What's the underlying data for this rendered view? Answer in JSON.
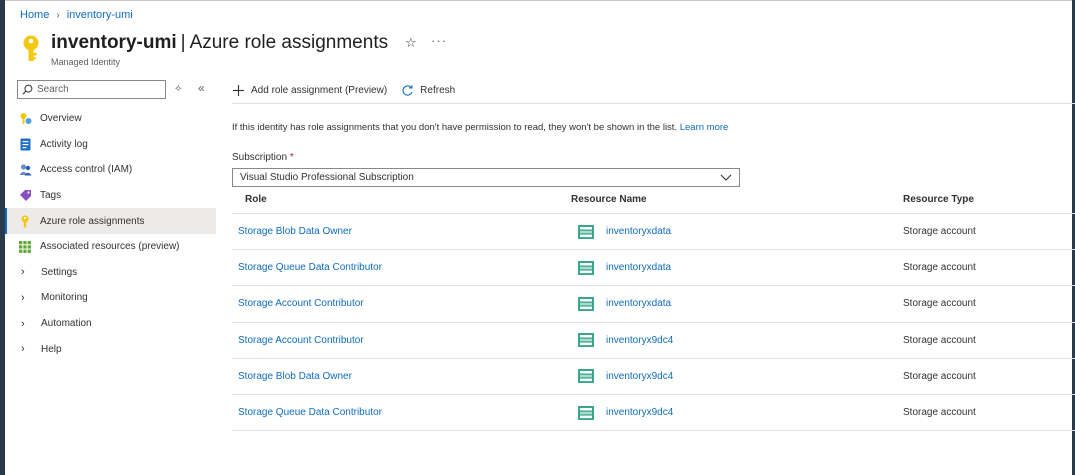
{
  "breadcrumb": {
    "home": "Home",
    "resource": "inventory-umi"
  },
  "header": {
    "resource_name": "inventory-umi",
    "separator": "|",
    "page_title": "Azure role assignments",
    "subtitle": "Managed Identity",
    "star_glyph": "☆",
    "more_glyph": "···"
  },
  "sidebar": {
    "search_placeholder": "Search",
    "ctrl_refresh_glyph": "⟡",
    "ctrl_collapse_glyph": "«",
    "items": [
      {
        "label": "Overview",
        "icon": "overview-icon"
      },
      {
        "label": "Activity log",
        "icon": "activity-log-icon"
      },
      {
        "label": "Access control (IAM)",
        "icon": "iam-icon"
      },
      {
        "label": "Tags",
        "icon": "tag-icon"
      },
      {
        "label": "Azure role assignments",
        "icon": "key-icon",
        "active": true
      },
      {
        "label": "Associated resources (preview)",
        "icon": "grid-icon"
      },
      {
        "label": "Settings",
        "expandable": true
      },
      {
        "label": "Monitoring",
        "expandable": true
      },
      {
        "label": "Automation",
        "expandable": true
      },
      {
        "label": "Help",
        "expandable": true
      }
    ]
  },
  "toolbar": {
    "add_label": "Add role assignment (Preview)",
    "refresh_label": "Refresh"
  },
  "info": {
    "text": "If this identity has role assignments that you don't have permission to read, they won't be shown in the list. ",
    "link": "Learn more"
  },
  "subscription": {
    "label": "Subscription",
    "required": "*",
    "value": "Visual Studio Professional Subscription"
  },
  "table": {
    "headers": [
      "Role",
      "Resource Name",
      "Resource Type"
    ],
    "rows": [
      {
        "role": "Storage Blob Data Owner",
        "resource": "inventoryxdata",
        "type": "Storage account"
      },
      {
        "role": "Storage Queue Data Contributor",
        "resource": "inventoryxdata",
        "type": "Storage account"
      },
      {
        "role": "Storage Account Contributor",
        "resource": "inventoryxdata",
        "type": "Storage account"
      },
      {
        "role": "Storage Account Contributor",
        "resource": "inventoryx9dc4",
        "type": "Storage account"
      },
      {
        "role": "Storage Blob Data Owner",
        "resource": "inventoryx9dc4",
        "type": "Storage account"
      },
      {
        "role": "Storage Queue Data Contributor",
        "resource": "inventoryx9dc4",
        "type": "Storage account"
      }
    ]
  },
  "colors": {
    "link": "#0f6cbd",
    "key": "#f2c811",
    "active_bar": "#0f6cbd"
  }
}
